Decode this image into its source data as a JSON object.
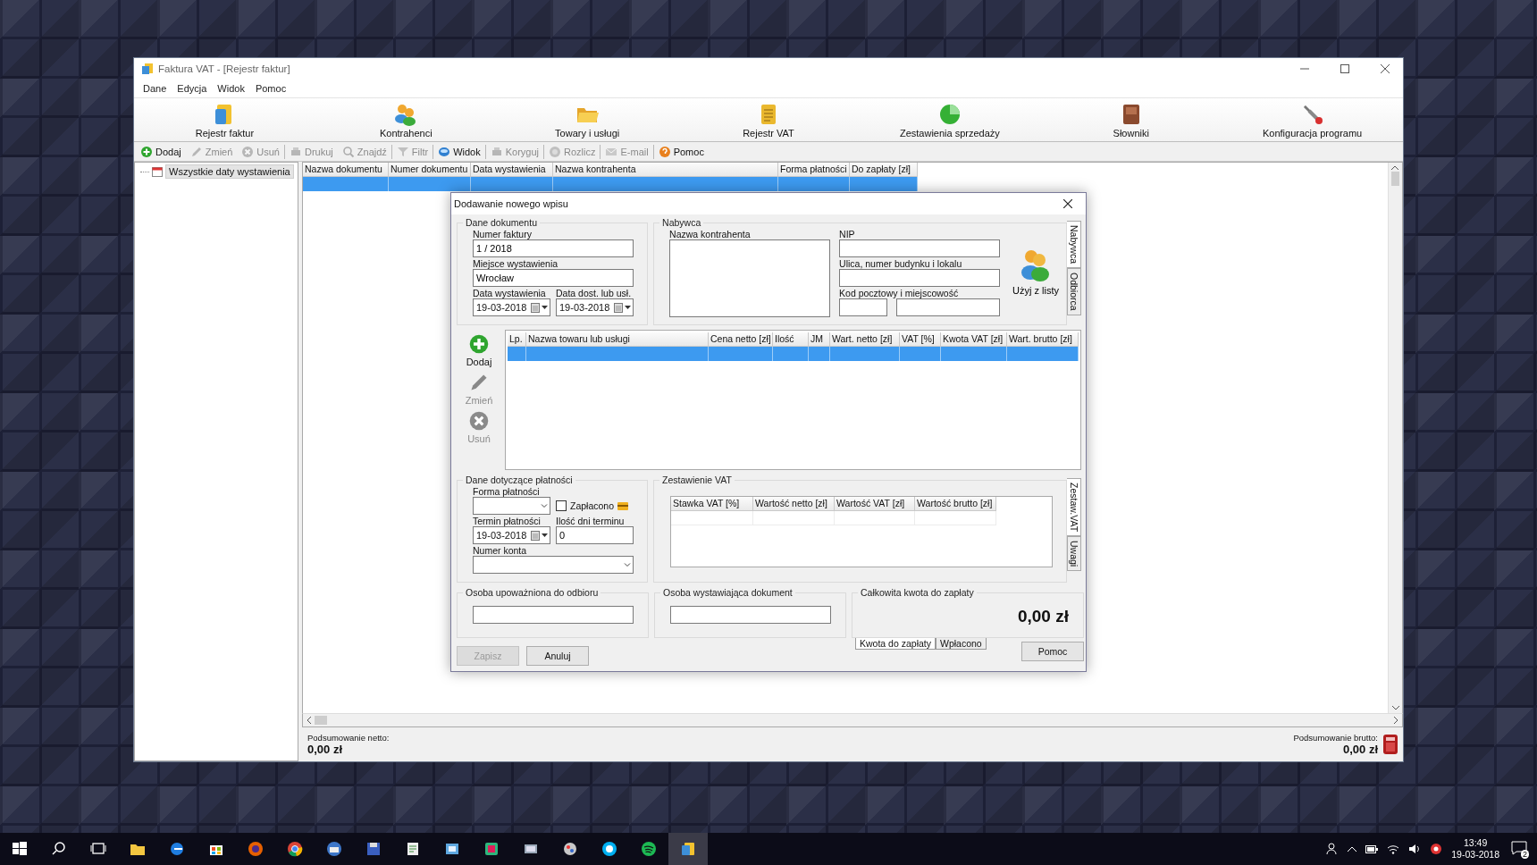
{
  "window": {
    "title": "Faktura VAT - [Rejestr faktur]"
  },
  "menu": [
    "Dane",
    "Edycja",
    "Widok",
    "Pomoc"
  ],
  "toolbar": [
    {
      "label": "Rejestr faktur",
      "kind": "invoice"
    },
    {
      "label": "Kontrahenci",
      "kind": "contacts"
    },
    {
      "label": "Towary i usługi",
      "kind": "goods"
    },
    {
      "label": "Rejestr VAT",
      "kind": "vat"
    },
    {
      "label": "Zestawienia sprzedaży",
      "kind": "reports"
    },
    {
      "label": "Słowniki",
      "kind": "dictionaries"
    },
    {
      "label": "Konfiguracja programu",
      "kind": "settings"
    }
  ],
  "actions": [
    {
      "label": "Dodaj",
      "kind": "add",
      "disabled": false
    },
    {
      "label": "Zmień",
      "kind": "edit",
      "disabled": true
    },
    {
      "label": "Usuń",
      "kind": "delete",
      "disabled": true
    },
    {
      "label": "Drukuj",
      "kind": "print",
      "disabled": true
    },
    {
      "label": "Znajdź",
      "kind": "find",
      "disabled": true
    },
    {
      "label": "Filtr",
      "kind": "filter",
      "disabled": true
    },
    {
      "label": "Widok",
      "kind": "view",
      "disabled": false
    },
    {
      "label": "Koryguj",
      "kind": "correct",
      "disabled": true
    },
    {
      "label": "Rozlicz",
      "kind": "settle",
      "disabled": true
    },
    {
      "label": "E-mail",
      "kind": "email",
      "disabled": true
    },
    {
      "label": "Pomoc",
      "kind": "help",
      "disabled": false
    }
  ],
  "tree": [
    {
      "label": "Wszystkie daty wystawienia",
      "selected": true
    }
  ],
  "register": {
    "columns": [
      "Nazwa dokumentu",
      "Numer dokumentu",
      "Data wystawienia",
      "Nazwa kontrahenta",
      "Forma płatności",
      "Do zapłaty [zł]"
    ],
    "rows": [
      {
        "selected": true
      }
    ]
  },
  "summary": {
    "net_label": "Podsumowanie netto:",
    "net": "0,00 zł",
    "gross_label": "Podsumowanie brutto:",
    "gross": "0,00 zł"
  },
  "dialog": {
    "title": "Dodawanie nowego wpisu",
    "document": {
      "legend": "Dane dokumentu",
      "number_label": "Numer faktury",
      "number": "1 / 2018",
      "place_label": "Miejsce wystawienia",
      "place": "Wrocław",
      "issue_label": "Data wystawienia",
      "issue": "19-03-2018",
      "delivery_label": "Data dost. lub usł.",
      "delivery": "19-03-2018"
    },
    "buyer": {
      "legend": "Nabywca",
      "name_label": "Nazwa kontrahenta",
      "nip_label": "NIP",
      "street_label": "Ulica, numer budynku i lokalu",
      "postal_label": "Kod pocztowy i miejscowość",
      "use_list": "Użyj z listy",
      "side_tabs": [
        {
          "label": "Nabywca",
          "selected": true
        },
        {
          "label": "Odbiorca",
          "selected": false
        }
      ]
    },
    "items": {
      "buttons": [
        {
          "label": "Dodaj",
          "kind": "add",
          "disabled": false
        },
        {
          "label": "Zmień",
          "kind": "edit",
          "disabled": true
        },
        {
          "label": "Usuń",
          "kind": "delete",
          "disabled": true
        }
      ],
      "columns": [
        "Lp.",
        "Nazwa towaru lub usługi",
        "Cena netto [zł]",
        "Ilość",
        "JM",
        "Wart. netto [zł]",
        "VAT [%]",
        "Kwota VAT [zł]",
        "Wart. brutto [zł]"
      ],
      "rows": [
        {
          "selected": true
        }
      ]
    },
    "payment": {
      "legend": "Dane dotyczące płatności",
      "method_label": "Forma płatności",
      "paid_label": "Zapłacono",
      "paid": false,
      "due_label": "Termin płatności",
      "due": "19-03-2018",
      "days_label": "Ilość dni terminu",
      "days": "0",
      "account_label": "Numer konta"
    },
    "vat": {
      "legend": "Zestawienie VAT",
      "columns": [
        "Stawka VAT [%]",
        "Wartość netto [zł]",
        "Wartość VAT [zł]",
        "Wartość brutto [zł]"
      ],
      "side_tabs": [
        {
          "label": "Zestaw.VAT",
          "selected": true
        },
        {
          "label": "Uwagi",
          "selected": false
        }
      ]
    },
    "receiver": {
      "legend": "Osoba upoważniona do odbioru"
    },
    "issuer": {
      "legend": "Osoba wystawiająca dokument"
    },
    "total": {
      "legend": "Całkowita kwota do zapłaty",
      "amount": "0,00 zł",
      "tabs": [
        {
          "label": "Kwota do zapłaty",
          "selected": true
        },
        {
          "label": "Wpłacono",
          "selected": false
        }
      ]
    },
    "buttons": [
      {
        "label": "Zapisz",
        "disabled": true
      },
      {
        "label": "Anuluj",
        "disabled": false
      },
      {
        "label": "Pomoc",
        "disabled": false
      }
    ]
  },
  "taskbar": {
    "time": "13:49",
    "date": "19-03-2018",
    "notifications": "2"
  }
}
